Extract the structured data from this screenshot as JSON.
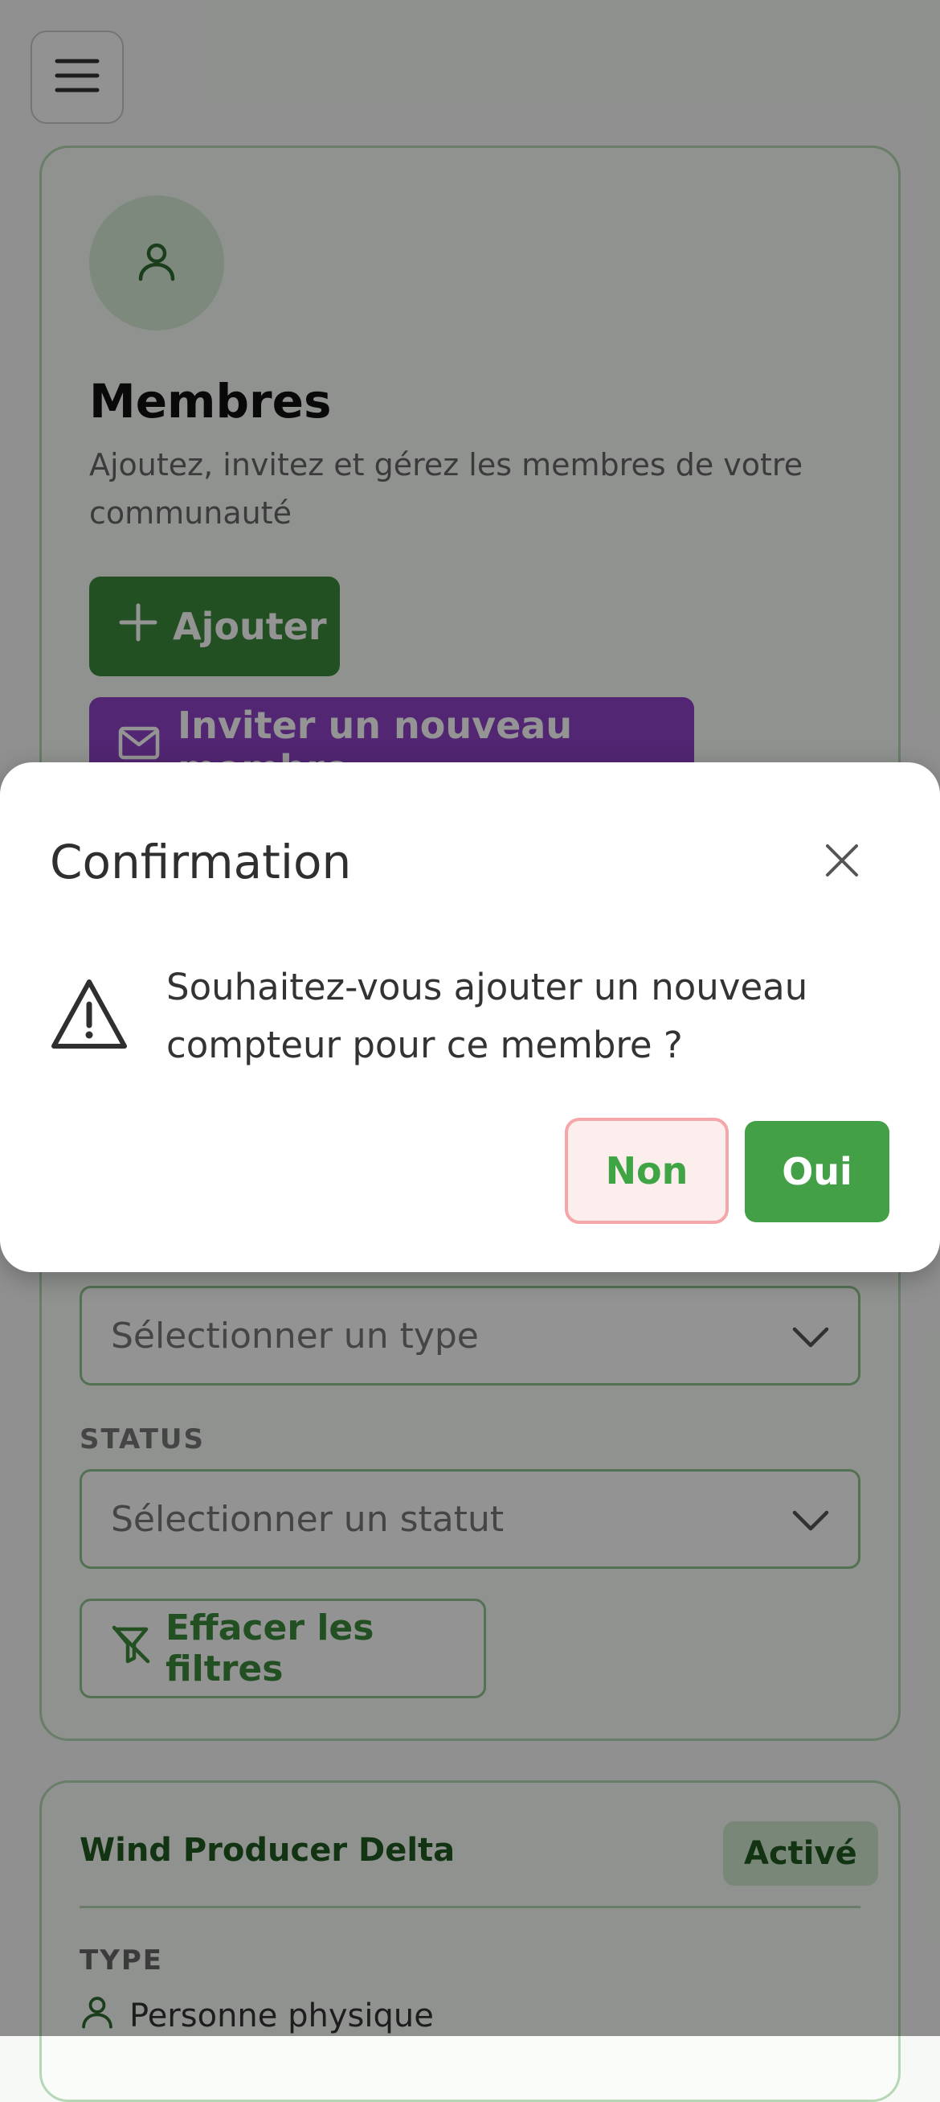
{
  "header": {
    "menu_icon": "hamburger-icon"
  },
  "members_card": {
    "avatar_icon": "user-icon",
    "title": "Membres",
    "subtitle": "Ajoutez, invitez et gérez les membres de votre communauté",
    "add_button": "Ajouter",
    "invite_button": "Inviter un nouveau membre"
  },
  "filters": {
    "type_placeholder": "Sélectionner un type",
    "status_label": "STATUS",
    "status_placeholder": "Sélectionner un statut",
    "clear_button": "Effacer les filtres"
  },
  "member": {
    "name": "Wind Producer Delta",
    "status": "Activé",
    "type_label": "TYPE",
    "type_value": "Personne physique"
  },
  "dialog": {
    "title": "Confirmation",
    "message": "Souhaitez-vous ajouter un nouveau compteur pour ce membre ?",
    "no_button": "Non",
    "yes_button": "Oui",
    "icons": [
      "close-icon",
      "warning-icon"
    ]
  },
  "colors": {
    "primary_green": "#43a047",
    "invite_purple": "#8e43c5",
    "danger_border": "#f4a6a9"
  }
}
